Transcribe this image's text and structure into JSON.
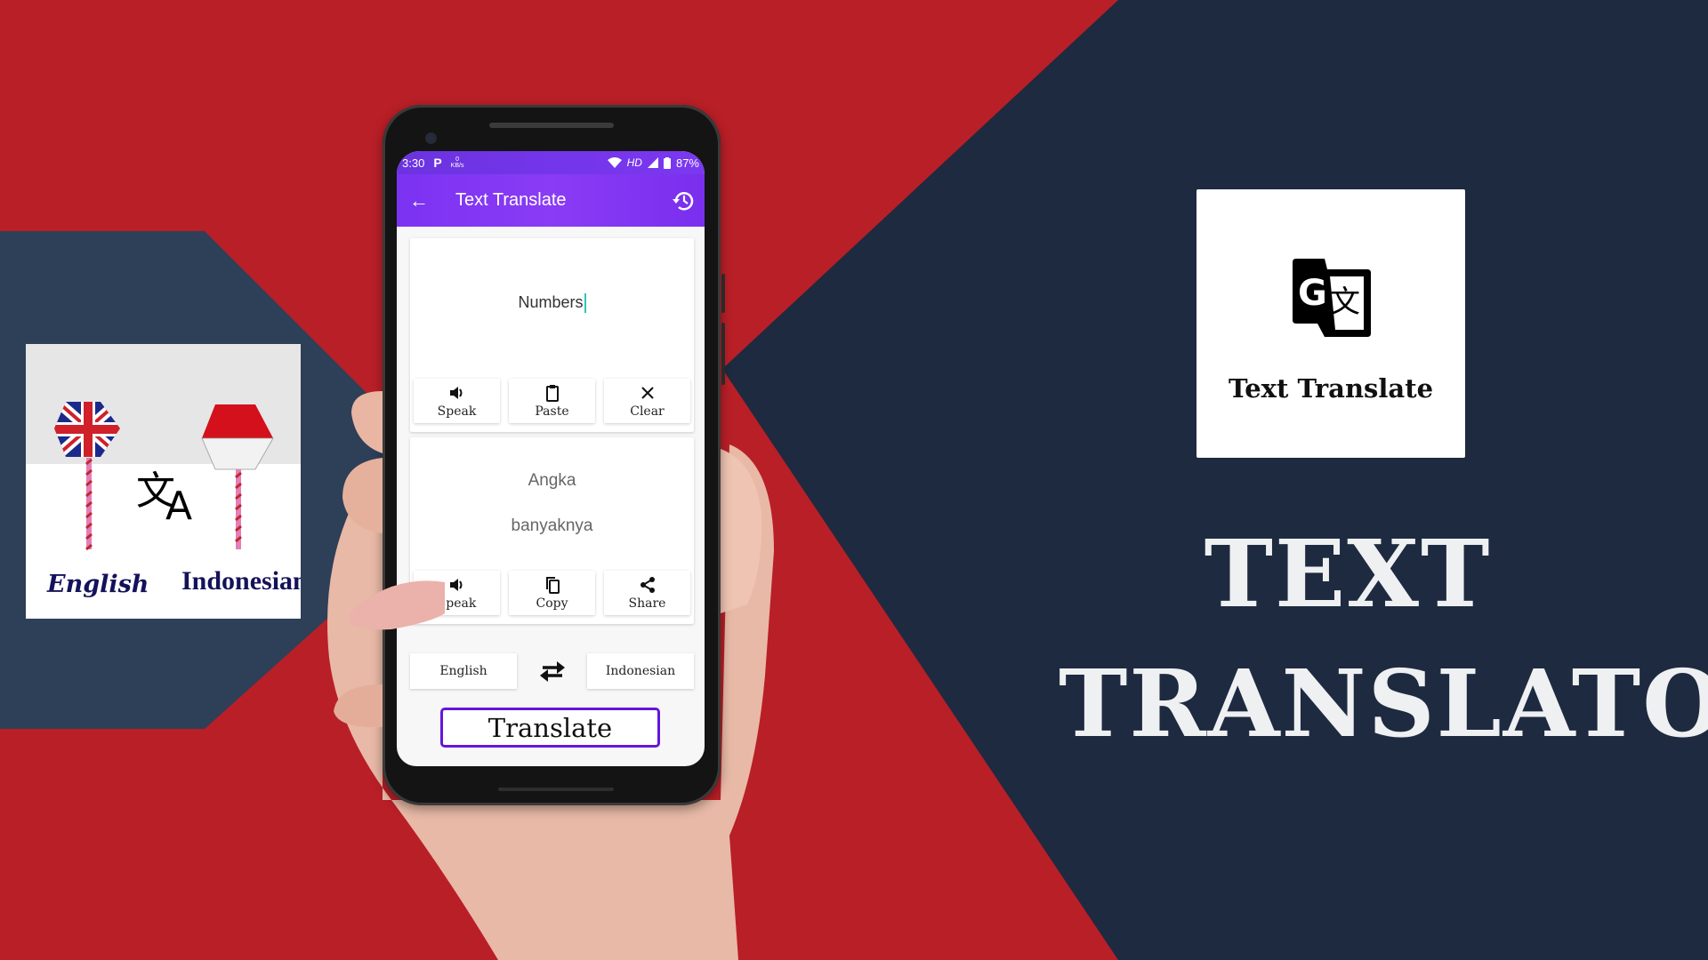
{
  "colors": {
    "background_red": "#b91f27",
    "background_navy": "#1e2a40",
    "left_band_navy": "#2e3f58",
    "app_purple": "#7b33f2",
    "translate_border": "#6416dc",
    "caret": "#2dc7b8"
  },
  "left_panel": {
    "source_language": "English",
    "target_language": "Indonesian",
    "source_flag": "uk-flag-icon",
    "target_flag": "indonesia-flag-icon",
    "center_icon": "translate-icon"
  },
  "right_card": {
    "icon": "google-translate-icon",
    "title": "Text Translate"
  },
  "headline": {
    "line1": "TEXT",
    "line2": "TRANSLATOR"
  },
  "phone": {
    "status_bar": {
      "time": "3:30",
      "p_icon": "P",
      "speed_value": "0",
      "speed_unit": "KB/s",
      "hd": "HD",
      "battery": "87%"
    },
    "app_bar": {
      "title": "Text Translate",
      "back_icon": "arrow-left-icon",
      "history_icon": "history-icon"
    },
    "input": {
      "value": "Numbers",
      "buttons": [
        {
          "label": "Speak",
          "icon": "speaker-icon"
        },
        {
          "label": "Paste",
          "icon": "clipboard-icon"
        },
        {
          "label": "Clear",
          "icon": "close-icon"
        }
      ]
    },
    "output": {
      "line1": "Angka",
      "line2": "banyaknya",
      "buttons": [
        {
          "label": "Speak",
          "icon": "speaker-icon"
        },
        {
          "label": "Copy",
          "icon": "copy-icon"
        },
        {
          "label": "Share",
          "icon": "share-icon"
        }
      ]
    },
    "languages": {
      "source": "English",
      "target": "Indonesian",
      "swap_icon": "swap-icon"
    },
    "translate_button": "Translate"
  }
}
